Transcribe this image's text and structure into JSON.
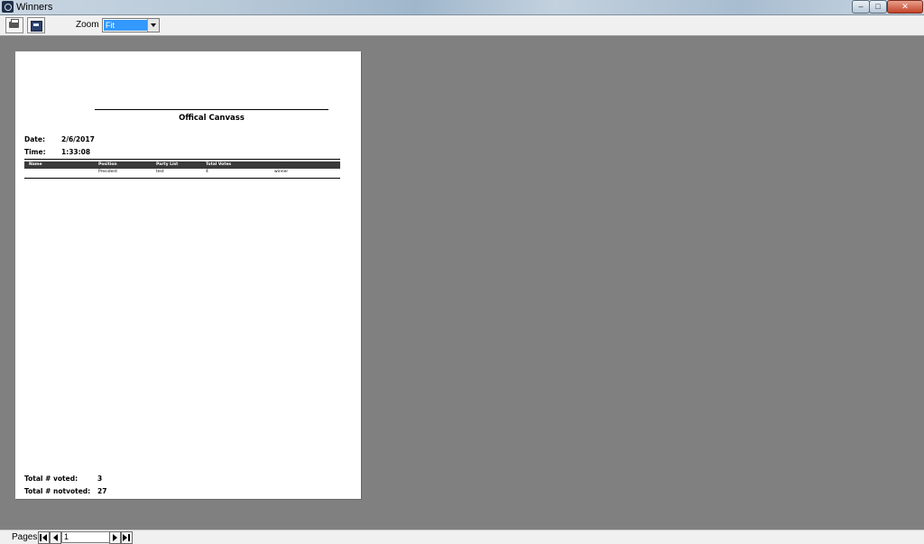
{
  "window": {
    "title": "Winners",
    "controls": {
      "minimize": "–",
      "maximize": "□",
      "close": "✕"
    }
  },
  "toolbar": {
    "print_icon": "printer-icon",
    "export_icon": "export-icon",
    "zoom_label": "Zoom",
    "zoom_value": "Fit"
  },
  "report": {
    "title": "Offical Canvass",
    "date_label": "Date:",
    "date_value": "2/6/2017",
    "time_label": "Time:",
    "time_value": "1:33:08",
    "columns": [
      "Name",
      "Position",
      "Party List",
      "Total Votes"
    ],
    "rows": [
      {
        "name": "",
        "position": "President",
        "party_list": "test",
        "total_votes": "4",
        "status": "winner"
      }
    ],
    "voted_label": "Total # voted:",
    "voted_value": "3",
    "notvoted_label": "Total # notvoted:",
    "notvoted_value": "27"
  },
  "pager": {
    "label": "Pages:",
    "current_page": "1"
  }
}
